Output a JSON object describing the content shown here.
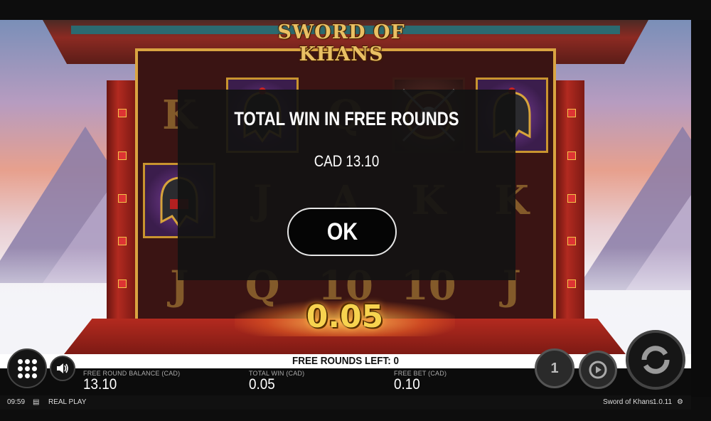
{
  "game": {
    "logo": "SWORD OF KHANS",
    "win_display": "0.05",
    "reels": [
      [
        "K",
        "helmet",
        "Q",
        "shield",
        "helmet"
      ],
      [
        "helmet",
        "J",
        "A",
        "K",
        "K"
      ],
      [
        "J",
        "Q",
        "10",
        "10",
        "J"
      ]
    ]
  },
  "dialog": {
    "title": "TOTAL WIN IN FREE ROUNDS",
    "amount": "CAD 13.10",
    "ok_label": "OK"
  },
  "bar": {
    "free_rounds_left": "FREE ROUNDS LEFT: 0"
  },
  "info": {
    "balance_label": "FREE ROUND BALANCE (CAD)",
    "balance_value": "13.10",
    "total_win_label": "TOTAL WIN (CAD)",
    "total_win_value": "0.05",
    "free_bet_label": "FREE BET (CAD)",
    "free_bet_value": "0.10"
  },
  "status": {
    "time": "09:59",
    "mode": "REAL PLAY",
    "game_name": "Sword of Khans",
    "version": "1.0.11"
  },
  "controls": {
    "bet_level": "1"
  }
}
